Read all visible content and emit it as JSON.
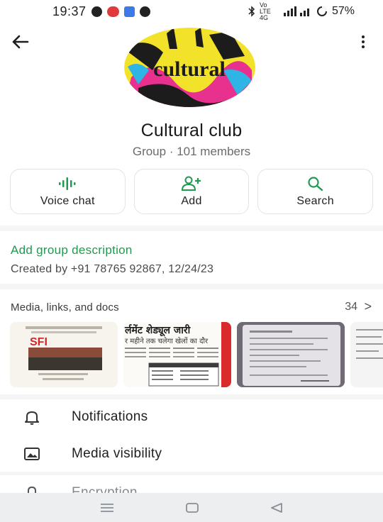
{
  "status_bar": {
    "time": "19:37",
    "network": "Vo LTE 4G",
    "battery": "57%",
    "icons": [
      "youtube-icon",
      "jio-icon",
      "app-icon",
      "shield-icon",
      "bluetooth-icon",
      "signal-icon",
      "battery-icon"
    ]
  },
  "header": {
    "back_icon": "arrow-left-icon",
    "menu_icon": "more-vertical-icon",
    "avatar_text": "cultural",
    "title": "Cultural club",
    "subtitle": "Group · 101 members"
  },
  "actions": [
    {
      "label": "Voice chat",
      "icon": "voice-wave-icon"
    },
    {
      "label": "Add",
      "icon": "add-person-icon"
    },
    {
      "label": "Search",
      "icon": "search-icon"
    }
  ],
  "description": {
    "link": "Add group description",
    "created": "Created by +91 78765 92867, 12/24/23"
  },
  "media": {
    "title": "Media, links, and docs",
    "count": "34",
    "chevron": ">",
    "thumb_texts": [
      "SFI",
      "र्लमेंट शेड्यूल जारी",
      "र महीने तक चलेगा खेलों का दौर"
    ]
  },
  "settings": [
    {
      "label": "Notifications",
      "icon": "bell-icon"
    },
    {
      "label": "Media visibility",
      "icon": "image-icon"
    },
    {
      "label": "Encryption",
      "icon": "lock-icon"
    }
  ],
  "colors": {
    "accent": "#1f9a4f",
    "card_bg": "#ffffff",
    "page_bg": "#f4f5f4"
  }
}
